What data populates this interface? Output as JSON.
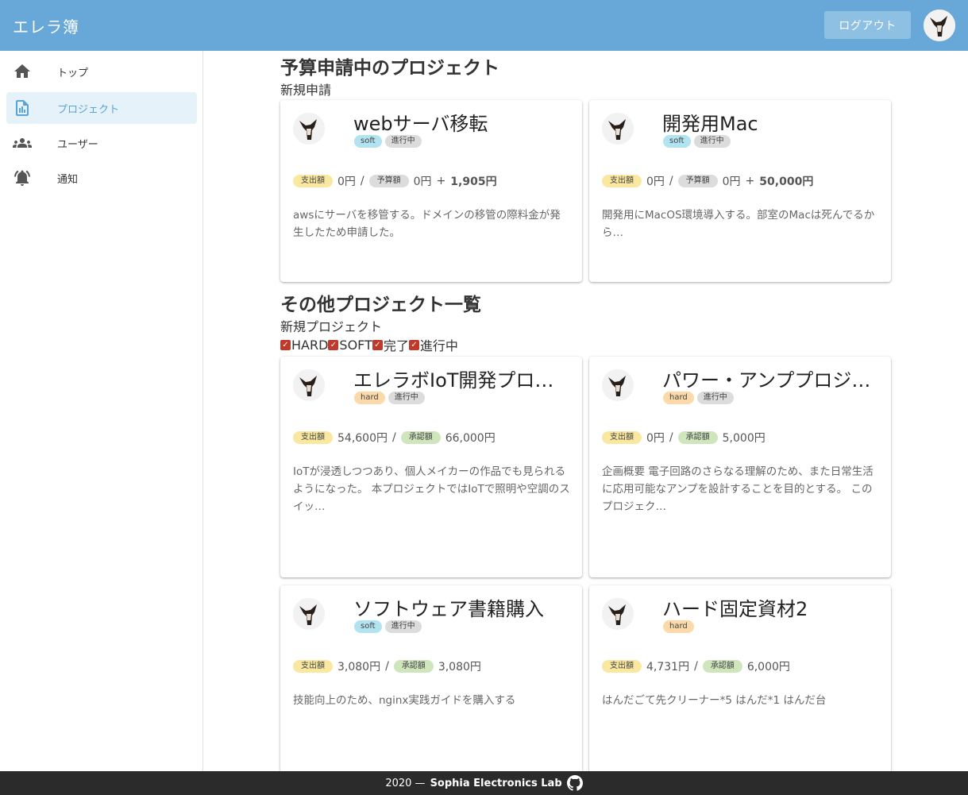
{
  "app": {
    "title": "エレラ簿",
    "logout_label": "ログアウト"
  },
  "sidebar": {
    "items": [
      {
        "label": "トップ",
        "icon": "home-icon"
      },
      {
        "label": "プロジェクト",
        "icon": "project-report-icon",
        "active": true
      },
      {
        "label": "ユーザー",
        "icon": "users-icon"
      },
      {
        "label": "通知",
        "icon": "alarm-bell-icon"
      }
    ]
  },
  "pending": {
    "title": "予算申請中のプロジェクト",
    "new_label": "新規申請",
    "cards": [
      {
        "title": "webサーバ移転",
        "tags": [
          "soft",
          "進行中"
        ],
        "spent_label": "支出額",
        "spent": "0円",
        "budget_label": "予算額",
        "budget": "0円",
        "plus": "+",
        "request": "1,905円",
        "description": "awsにサーバを移管する。ドメインの移管の際料金が発生したため申請した。"
      },
      {
        "title": "開発用Mac",
        "tags": [
          "soft",
          "進行中"
        ],
        "spent_label": "支出額",
        "spent": "0円",
        "budget_label": "予算額",
        "budget": "0円",
        "plus": "+",
        "request": "50,000円",
        "description": "開発用にMacOS環境導入する。部室のMacは死んでるから…"
      }
    ]
  },
  "others": {
    "title": "その他プロジェクト一覧",
    "new_label": "新規プロジェクト",
    "filters": [
      "HARD",
      "SOFT",
      "完了",
      "進行中"
    ],
    "cards": [
      {
        "title": "エレラボIoT開発プロ…",
        "tags": [
          "hard",
          "進行中"
        ],
        "spent_label": "支出額",
        "spent": "54,600円",
        "approved_label": "承認額",
        "approved": "66,000円",
        "description": "IoTが浸透しつつあり、個人メイカーの作品でも見られるようになった。 本プロジェクトではIoTで照明や空調のスイッ…"
      },
      {
        "title": "パワー・アンププロジ…",
        "tags": [
          "hard",
          "進行中"
        ],
        "spent_label": "支出額",
        "spent": "0円",
        "approved_label": "承認額",
        "approved": "5,000円",
        "description": "企画概要 電子回路のさらなる理解のため、また日常生活に応用可能なアンプを設計することを目的とする。 このプロジェク…"
      },
      {
        "title": "ソフトウェア書籍購入",
        "tags": [
          "soft",
          "進行中"
        ],
        "spent_label": "支出額",
        "spent": "3,080円",
        "approved_label": "承認額",
        "approved": "3,080円",
        "description": "技能向上のため、nginx実践ガイドを購入する"
      },
      {
        "title": "ハード固定資材2",
        "tags": [
          "hard"
        ],
        "spent_label": "支出額",
        "spent": "4,731円",
        "approved_label": "承認額",
        "approved": "6,000円",
        "description": "はんだごて先クリーナー*5 はんだ*1 はんだ台"
      }
    ]
  },
  "footer": {
    "year": "2020 —",
    "brand": "Sophia Electronics Lab",
    "icon": "github-icon"
  },
  "colors": {
    "appbar": "#67a8d8",
    "accent": "#5aa3d6",
    "soft_chip": "#b2e3f0",
    "hard_chip": "#fbd9a9"
  }
}
